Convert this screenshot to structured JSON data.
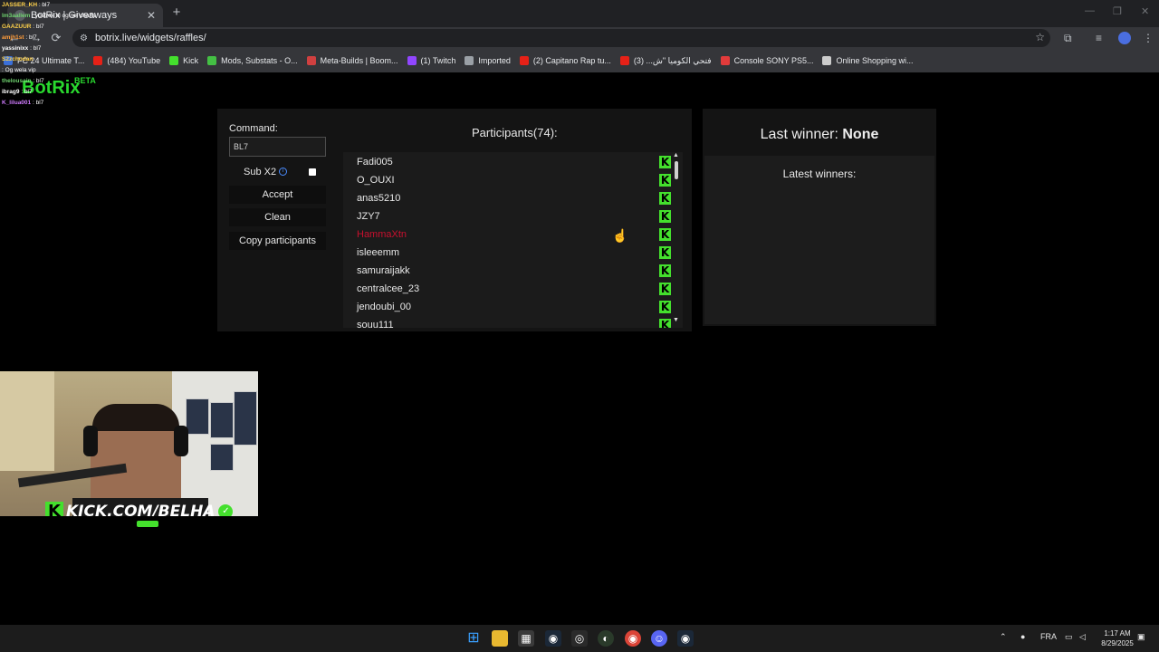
{
  "browser": {
    "tab_title": "BotRix | Giveaways",
    "tab_close": "✕",
    "new_tab": "+",
    "url": "botrix.live/widgets/raffles/",
    "nav": {
      "back": "←",
      "forward": "→",
      "reload": "⟳"
    },
    "window_controls": {
      "minimize": "—",
      "restore": "❐",
      "close": "✕"
    }
  },
  "bookmarks": [
    {
      "label": "FC 24 Ultimate T...",
      "color": "#3a6fd8"
    },
    {
      "label": "(484) YouTube",
      "color": "#e62117"
    },
    {
      "label": "Kick",
      "color": "#44e02d"
    },
    {
      "label": "Mods, Substats - O...",
      "color": "#44c044"
    },
    {
      "label": "Meta-Builds | Boom...",
      "color": "#d04040"
    },
    {
      "label": "(1) Twitch",
      "color": "#9146ff"
    },
    {
      "label": "Imported",
      "color": "#9aa0a6"
    },
    {
      "label": "(2) Capitano Rap tu...",
      "color": "#e62117"
    },
    {
      "label": "فتحي الكوميا \"ش... (3)",
      "color": "#e62117"
    },
    {
      "label": "Console SONY PS5...",
      "color": "#e23b3b"
    },
    {
      "label": "Online Shopping wi...",
      "color": "#cccccc"
    }
  ],
  "brand": {
    "name": "BotRix",
    "beta": "BETA"
  },
  "raffle": {
    "command_label": "Command:",
    "command_value": "BL7",
    "sub_label": "Sub X2",
    "sub_checked": false,
    "buttons": {
      "accept": "Accept",
      "clean": "Clean",
      "copy": "Copy participants"
    },
    "participants_title": "Participants(74):",
    "participants": [
      {
        "name": "Fadi005",
        "highlight": false
      },
      {
        "name": "O_OUXI",
        "highlight": false
      },
      {
        "name": "anas5210",
        "highlight": false
      },
      {
        "name": "JZY7",
        "highlight": false
      },
      {
        "name": "HammaXtn",
        "highlight": true
      },
      {
        "name": "isleeemm",
        "highlight": false
      },
      {
        "name": "samuraijakk",
        "highlight": false
      },
      {
        "name": "centralcee_23",
        "highlight": false
      },
      {
        "name": "jendoubi_00",
        "highlight": false
      },
      {
        "name": "souu111",
        "highlight": false
      }
    ],
    "last_winner_label": "Last winner:",
    "last_winner_value": "None",
    "latest_winners_label": "Latest winners:"
  },
  "chat": [
    {
      "user": "JASSER_KH",
      "msg": " : bl7",
      "color": "#ffd24a"
    },
    {
      "user": "lm3aallem",
      "msg": " : yostrek bl og nel chaffa",
      "color": "#6fd16f"
    },
    {
      "user": "GAAZUUR",
      "msg": " : bl7",
      "color": "#ffd24a"
    },
    {
      "user": "amjh1st",
      "msg": " : bl7",
      "color": "#ff9d3b"
    },
    {
      "user": "yassinixx",
      "msg": " : bl7",
      "color": "#ffffff"
    },
    {
      "user": "S2zchodan",
      "msg": "",
      "color": "#ffd24a"
    },
    {
      "user": "",
      "msg": ": Og wela vip",
      "color": "#ff4d4d"
    },
    {
      "user": "thelousain",
      "msg": " : bl7",
      "color": "#6fd16f"
    },
    {
      "user": "ibrag9",
      "msg": " : bl7",
      "color": "#ffffff"
    },
    {
      "user": "K_lilua001",
      "msg": " : bl7",
      "color": "#d07bff"
    }
  ],
  "webcam": {
    "banner": "KICK.COM/BELHA"
  },
  "taskbar": {
    "language": "FRA",
    "time": "1:17 AM",
    "date": "8/29/2025"
  }
}
